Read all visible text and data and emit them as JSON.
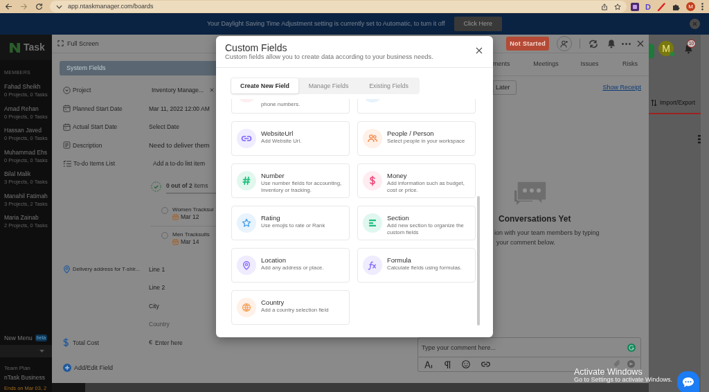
{
  "browser": {
    "url": "app.ntaskmanager.com/boards",
    "extension_letter": "D",
    "profile_initial": "M"
  },
  "banner": {
    "message": "Your Daylight Saving Time Adjustment setting is currently set to Automatic, to turn it off",
    "button": "Click Here"
  },
  "sidebar": {
    "logo": "Task",
    "heading": "MEMBERS",
    "members": [
      {
        "name": "Fahad Sheikh",
        "summary": "0 Projects, 0 Tasks"
      },
      {
        "name": "Amad Rehan",
        "summary": "0 Projects, 0 Tasks"
      },
      {
        "name": "Hassan Javed",
        "summary": "0 Projects, 0 Tasks"
      },
      {
        "name": "Muhammad Ehs",
        "summary": "0 Projects, 0 Tasks"
      },
      {
        "name": "Bilal Malik",
        "summary": "3 Projects, 0 Tasks"
      },
      {
        "name": "Manahil Fatimah",
        "summary": "3 Projects, 2 Tasks"
      },
      {
        "name": "Maria Zainab",
        "summary": "2 Projects, 0 Tasks"
      }
    ],
    "new_menu": {
      "label": "New Menu",
      "badge": "beta"
    },
    "plan": {
      "caption": "Team Plan",
      "name": "nTask Business",
      "expiry": "Ends on Mar 03, 2"
    }
  },
  "task_panel": {
    "full_screen": "Full Screen",
    "status": "Not Started",
    "section": "System Fields",
    "fields": [
      {
        "kind": "project",
        "label": "Project",
        "value": "Inventory Manage..."
      },
      {
        "kind": "date",
        "label": "Planned Start Date",
        "value": "Mar 11, 2022 12:00 AM"
      },
      {
        "kind": "date",
        "label": "Actual Start Date",
        "placeholder": "Select Date"
      },
      {
        "kind": "description",
        "label": "Description",
        "value": "Need to deliver them"
      },
      {
        "kind": "todo",
        "label": "To-do Items List",
        "placeholder": "Add a to-do list item"
      }
    ],
    "todo_progress": {
      "text": "**0 out of 2** items",
      "level": 0
    },
    "todo_items": [
      {
        "title": "Women Tracksui",
        "due": "Mar 12",
        "checked": false
      },
      {
        "title": "Men Tracksuits",
        "due": "Mar 14",
        "checked": false
      }
    ],
    "address": {
      "label": "Delivery address for T-shir...",
      "lines": [
        {
          "placeholder": "Line 1",
          "disabled": false
        },
        {
          "placeholder": "Line 2",
          "disabled": false
        },
        {
          "placeholder": "City",
          "disabled": false
        },
        {
          "placeholder": "Country",
          "disabled": true
        }
      ]
    },
    "cost": {
      "label": "Total Cost",
      "currency": "€",
      "placeholder": "Enter here"
    },
    "add_field": "Add/Edit Field",
    "tabs": [
      {
        "label": "ments",
        "selected": false
      },
      {
        "label": "Meetings",
        "selected": false
      },
      {
        "label": "Issues",
        "selected": false
      },
      {
        "label": "Risks",
        "selected": false
      }
    ],
    "later_button": "Later",
    "receipt_link": "Show Receipt",
    "empty_state": {
      "title": "Conversations Yet",
      "lines": [
        "ion with your team members by typing",
        "your comment below."
      ]
    },
    "comment": {
      "placeholder": "Type your comment here..."
    }
  },
  "board": {
    "avatar_initial": "M",
    "notification_count": "10",
    "import_export": "Import/Export"
  },
  "custom_fields": {
    "title": "Custom Fields",
    "subtitle": "Custom fields allow you to create data according to your business needs.",
    "tabs": [
      {
        "label": "Create New Field",
        "selected": true
      },
      {
        "label": "Manage Fields",
        "selected": false
      },
      {
        "label": "Existing Fields",
        "selected": false
      }
    ],
    "cut_cards": [
      {
        "color": "#fdeef1",
        "description": "phone numbers."
      },
      {
        "color": "#e6f2fc"
      }
    ],
    "cards": [
      {
        "kind": "url",
        "title": "WebsiteUrl",
        "description": "Add Website Url."
      },
      {
        "kind": "people",
        "title": "People / Person",
        "description": "Select people in your workspace"
      },
      {
        "kind": "number",
        "title": "Number",
        "description": "Use number fields for accounting, Inventory or tracking."
      },
      {
        "kind": "money",
        "title": "Money",
        "description": "Add information such as budget, cost or price."
      },
      {
        "kind": "rating",
        "title": "Rating",
        "description": "Use emojis to rate or Rank"
      },
      {
        "kind": "section",
        "title": "Section",
        "description": "Add new section to organize the custom fields"
      },
      {
        "kind": "location",
        "title": "Location",
        "description": "Add any address or place."
      },
      {
        "kind": "formula",
        "title": "Formula",
        "description": "Calculate fields using formulas."
      },
      {
        "kind": "country",
        "title": "Country",
        "description": "Add a country selection field"
      }
    ]
  },
  "os_notice": {
    "title": "Activate Windows",
    "detail": "Go to Settings to activate Windows."
  }
}
